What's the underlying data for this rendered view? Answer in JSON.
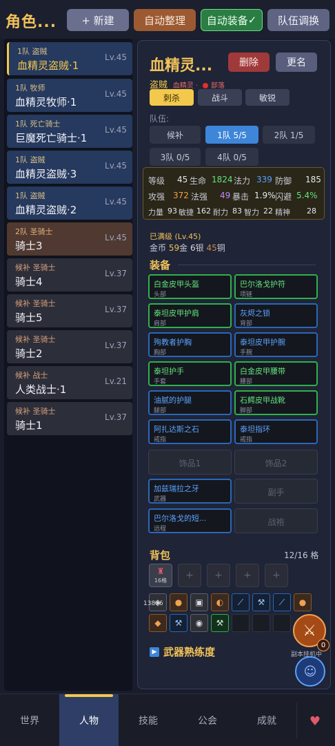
{
  "header": {
    "title": "角色...",
    "new_label": "+ 新建",
    "sort_label": "自动整理",
    "auto_equip_label": "自动装备",
    "auto_equip_check": "✓",
    "team_label": "队伍调换"
  },
  "characters": [
    {
      "tag": "1队 盗贼",
      "name": "血精灵盗贼·1",
      "level": "Lv.45"
    },
    {
      "tag": "1队 牧师",
      "name": "血精灵牧师·1",
      "level": "Lv.45"
    },
    {
      "tag": "1队 死亡骑士",
      "name": "巨魔死亡骑士·1",
      "level": "Lv.45"
    },
    {
      "tag": "1队 盗贼",
      "name": "血精灵盗贼·3",
      "level": "Lv.45"
    },
    {
      "tag": "1队 盗贼",
      "name": "血精灵盗贼·2",
      "level": "Lv.45"
    },
    {
      "tag": "2队 圣骑士",
      "name": "骑士3",
      "level": "Lv.45"
    },
    {
      "tag": "候补 圣骑士",
      "name": "骑士4",
      "level": "Lv.37"
    },
    {
      "tag": "候补 圣骑士",
      "name": "骑士5",
      "level": "Lv.37"
    },
    {
      "tag": "候补 圣骑士",
      "name": "骑士2",
      "level": "Lv.37"
    },
    {
      "tag": "候补 战士",
      "name": "人类战士·1",
      "level": "Lv.21"
    },
    {
      "tag": "候补 圣骑士",
      "name": "骑士1",
      "level": "Lv.37"
    }
  ],
  "detail": {
    "name": "血精灵...",
    "delete_label": "删除",
    "rename_label": "更名",
    "class": "盗贼",
    "race": "血精灵 ·",
    "faction": "部落",
    "styles": [
      "刺杀",
      "战斗",
      "敏锐"
    ],
    "team_title": "队伍:",
    "teams": [
      "候补",
      "1队 5/5",
      "2队 1/5",
      "3队 0/5",
      "4队 0/5"
    ],
    "stats": [
      {
        "l1": "等级",
        "v1": "45",
        "l2": "生命",
        "v2": "1824",
        "l3": "法力",
        "v3": "339",
        "l4": "防御",
        "v4": "185"
      },
      {
        "l1": "攻强",
        "v1": "372",
        "l2": "法强",
        "v2": "49",
        "l3": "暴击",
        "v3": "1.9%",
        "l4": "闪避",
        "v4": "5.4%"
      },
      {
        "l1": "力量",
        "v1": "93",
        "l2": "敏捷",
        "v2": "162",
        "l3": "耐力",
        "v3": "83",
        "l4": "智力",
        "v4": "22",
        "l5": "精神",
        "v5": "28"
      }
    ],
    "max_level": "已满级 (Lv.45)",
    "money_label": "金币",
    "gold": "59",
    "gold_unit": "金",
    "silver": "6",
    "silver_unit": "银",
    "copper": "45",
    "copper_unit": "铜",
    "equipment_title": "装备",
    "equipment": [
      {
        "name": "白金皮甲头盔",
        "slot": "头部"
      },
      {
        "name": "巴尔洛戈护符",
        "slot": "项链"
      },
      {
        "name": "泰坦皮甲护肩",
        "slot": "肩部"
      },
      {
        "name": "灰烬之锁",
        "slot": "背部"
      },
      {
        "name": "殉教者护胸",
        "slot": "胸部"
      },
      {
        "name": "泰坦皮甲护腕",
        "slot": "手腕"
      },
      {
        "name": "泰坦护手",
        "slot": "手套"
      },
      {
        "name": "白金皮甲腰带",
        "slot": "腰部"
      },
      {
        "name": "油腻的护腿",
        "slot": "腿部"
      },
      {
        "name": "石鳄皮甲战靴",
        "slot": "脚部"
      },
      {
        "name": "阿扎达斯之石",
        "slot": "戒指"
      },
      {
        "name": "泰坦指环",
        "slot": "戒指"
      },
      {
        "name": "饰品1",
        "slot": ""
      },
      {
        "name": "饰品2",
        "slot": ""
      },
      {
        "name": "加兹瑞拉之牙",
        "slot": "武器"
      },
      {
        "name": "副手",
        "slot": ""
      },
      {
        "name": "巴尔洛戈的短...",
        "slot": "远程"
      },
      {
        "name": "战袍",
        "slot": ""
      }
    ],
    "bag_title": "背包",
    "bag_count": "12/16 格",
    "bag_first_tab": "16格",
    "bag_add_label": "+",
    "item_count": "13896",
    "mastery_title": "武器熟练度"
  },
  "floating": {
    "battle_badge": "0",
    "battle_label": "副本挂机中"
  },
  "nav": {
    "items": [
      "世界",
      "人物",
      "技能",
      "公会",
      "成就"
    ],
    "active": "人物"
  },
  "icons": {
    "battle": "crossed-swords-icon",
    "avatar": "character-avatar-icon",
    "bag": "backpack-icon",
    "extra": "heart-icon"
  },
  "colors": {
    "accent_gold": "#f2c94c",
    "team_active": "#3e86d9",
    "green_quality": "#2fb14c",
    "blue_quality": "#2b67b8",
    "danger": "#a03a3a"
  }
}
